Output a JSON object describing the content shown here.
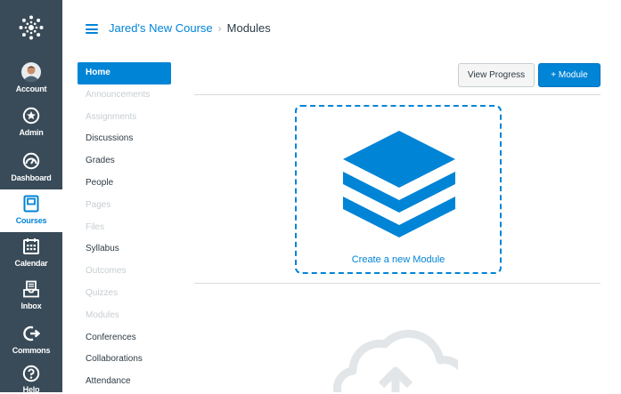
{
  "global_nav": {
    "logo_icon": "canvas-logo-icon",
    "items": [
      {
        "label": "Account",
        "icon": "avatar"
      },
      {
        "label": "Admin",
        "icon": "shield-icon"
      },
      {
        "label": "Dashboard",
        "icon": "dashboard-icon"
      },
      {
        "label": "Courses",
        "icon": "courses-icon"
      },
      {
        "label": "Calendar",
        "icon": "calendar-icon"
      },
      {
        "label": "Inbox",
        "icon": "inbox-icon"
      },
      {
        "label": "Commons",
        "icon": "commons-icon"
      },
      {
        "label": "Help",
        "icon": "help-icon"
      }
    ]
  },
  "header": {
    "menu_icon": "hamburger-icon",
    "breadcrumb": {
      "course": "Jared's New Course",
      "separator": "›",
      "current": "Modules"
    }
  },
  "course_nav": {
    "items": [
      {
        "label": "Home"
      },
      {
        "label": "Announcements"
      },
      {
        "label": "Assignments"
      },
      {
        "label": "Discussions"
      },
      {
        "label": "Grades"
      },
      {
        "label": "People"
      },
      {
        "label": "Pages"
      },
      {
        "label": "Files"
      },
      {
        "label": "Syllabus"
      },
      {
        "label": "Outcomes"
      },
      {
        "label": "Quizzes"
      },
      {
        "label": "Modules"
      },
      {
        "label": "Conferences"
      },
      {
        "label": "Collaborations"
      },
      {
        "label": "Attendance"
      }
    ]
  },
  "toolbar": {
    "view_progress_label": "View Progress",
    "add_module_label": "+ Module"
  },
  "empty_state": {
    "create_label": "Create a new Module",
    "stack_icon": "module-stack-icon",
    "cloud_icon": "cloud-upload-icon"
  },
  "colors": {
    "accent": "#0084d6",
    "nav_bg": "#394b58"
  }
}
